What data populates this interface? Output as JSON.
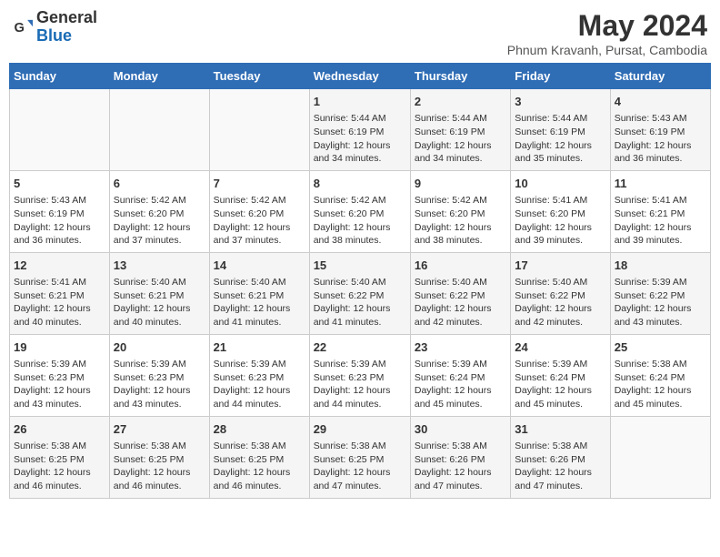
{
  "header": {
    "logo_general": "General",
    "logo_blue": "Blue",
    "title": "May 2024",
    "subtitle": "Phnum Kravanh, Pursat, Cambodia"
  },
  "days_of_week": [
    "Sunday",
    "Monday",
    "Tuesday",
    "Wednesday",
    "Thursday",
    "Friday",
    "Saturday"
  ],
  "weeks": [
    [
      {
        "day": "",
        "info": ""
      },
      {
        "day": "",
        "info": ""
      },
      {
        "day": "",
        "info": ""
      },
      {
        "day": "1",
        "info": "Sunrise: 5:44 AM\nSunset: 6:19 PM\nDaylight: 12 hours and 34 minutes."
      },
      {
        "day": "2",
        "info": "Sunrise: 5:44 AM\nSunset: 6:19 PM\nDaylight: 12 hours and 34 minutes."
      },
      {
        "day": "3",
        "info": "Sunrise: 5:44 AM\nSunset: 6:19 PM\nDaylight: 12 hours and 35 minutes."
      },
      {
        "day": "4",
        "info": "Sunrise: 5:43 AM\nSunset: 6:19 PM\nDaylight: 12 hours and 36 minutes."
      }
    ],
    [
      {
        "day": "5",
        "info": "Sunrise: 5:43 AM\nSunset: 6:19 PM\nDaylight: 12 hours and 36 minutes."
      },
      {
        "day": "6",
        "info": "Sunrise: 5:42 AM\nSunset: 6:20 PM\nDaylight: 12 hours and 37 minutes."
      },
      {
        "day": "7",
        "info": "Sunrise: 5:42 AM\nSunset: 6:20 PM\nDaylight: 12 hours and 37 minutes."
      },
      {
        "day": "8",
        "info": "Sunrise: 5:42 AM\nSunset: 6:20 PM\nDaylight: 12 hours and 38 minutes."
      },
      {
        "day": "9",
        "info": "Sunrise: 5:42 AM\nSunset: 6:20 PM\nDaylight: 12 hours and 38 minutes."
      },
      {
        "day": "10",
        "info": "Sunrise: 5:41 AM\nSunset: 6:20 PM\nDaylight: 12 hours and 39 minutes."
      },
      {
        "day": "11",
        "info": "Sunrise: 5:41 AM\nSunset: 6:21 PM\nDaylight: 12 hours and 39 minutes."
      }
    ],
    [
      {
        "day": "12",
        "info": "Sunrise: 5:41 AM\nSunset: 6:21 PM\nDaylight: 12 hours and 40 minutes."
      },
      {
        "day": "13",
        "info": "Sunrise: 5:40 AM\nSunset: 6:21 PM\nDaylight: 12 hours and 40 minutes."
      },
      {
        "day": "14",
        "info": "Sunrise: 5:40 AM\nSunset: 6:21 PM\nDaylight: 12 hours and 41 minutes."
      },
      {
        "day": "15",
        "info": "Sunrise: 5:40 AM\nSunset: 6:22 PM\nDaylight: 12 hours and 41 minutes."
      },
      {
        "day": "16",
        "info": "Sunrise: 5:40 AM\nSunset: 6:22 PM\nDaylight: 12 hours and 42 minutes."
      },
      {
        "day": "17",
        "info": "Sunrise: 5:40 AM\nSunset: 6:22 PM\nDaylight: 12 hours and 42 minutes."
      },
      {
        "day": "18",
        "info": "Sunrise: 5:39 AM\nSunset: 6:22 PM\nDaylight: 12 hours and 43 minutes."
      }
    ],
    [
      {
        "day": "19",
        "info": "Sunrise: 5:39 AM\nSunset: 6:23 PM\nDaylight: 12 hours and 43 minutes."
      },
      {
        "day": "20",
        "info": "Sunrise: 5:39 AM\nSunset: 6:23 PM\nDaylight: 12 hours and 43 minutes."
      },
      {
        "day": "21",
        "info": "Sunrise: 5:39 AM\nSunset: 6:23 PM\nDaylight: 12 hours and 44 minutes."
      },
      {
        "day": "22",
        "info": "Sunrise: 5:39 AM\nSunset: 6:23 PM\nDaylight: 12 hours and 44 minutes."
      },
      {
        "day": "23",
        "info": "Sunrise: 5:39 AM\nSunset: 6:24 PM\nDaylight: 12 hours and 45 minutes."
      },
      {
        "day": "24",
        "info": "Sunrise: 5:39 AM\nSunset: 6:24 PM\nDaylight: 12 hours and 45 minutes."
      },
      {
        "day": "25",
        "info": "Sunrise: 5:38 AM\nSunset: 6:24 PM\nDaylight: 12 hours and 45 minutes."
      }
    ],
    [
      {
        "day": "26",
        "info": "Sunrise: 5:38 AM\nSunset: 6:25 PM\nDaylight: 12 hours and 46 minutes."
      },
      {
        "day": "27",
        "info": "Sunrise: 5:38 AM\nSunset: 6:25 PM\nDaylight: 12 hours and 46 minutes."
      },
      {
        "day": "28",
        "info": "Sunrise: 5:38 AM\nSunset: 6:25 PM\nDaylight: 12 hours and 46 minutes."
      },
      {
        "day": "29",
        "info": "Sunrise: 5:38 AM\nSunset: 6:25 PM\nDaylight: 12 hours and 47 minutes."
      },
      {
        "day": "30",
        "info": "Sunrise: 5:38 AM\nSunset: 6:26 PM\nDaylight: 12 hours and 47 minutes."
      },
      {
        "day": "31",
        "info": "Sunrise: 5:38 AM\nSunset: 6:26 PM\nDaylight: 12 hours and 47 minutes."
      },
      {
        "day": "",
        "info": ""
      }
    ]
  ]
}
